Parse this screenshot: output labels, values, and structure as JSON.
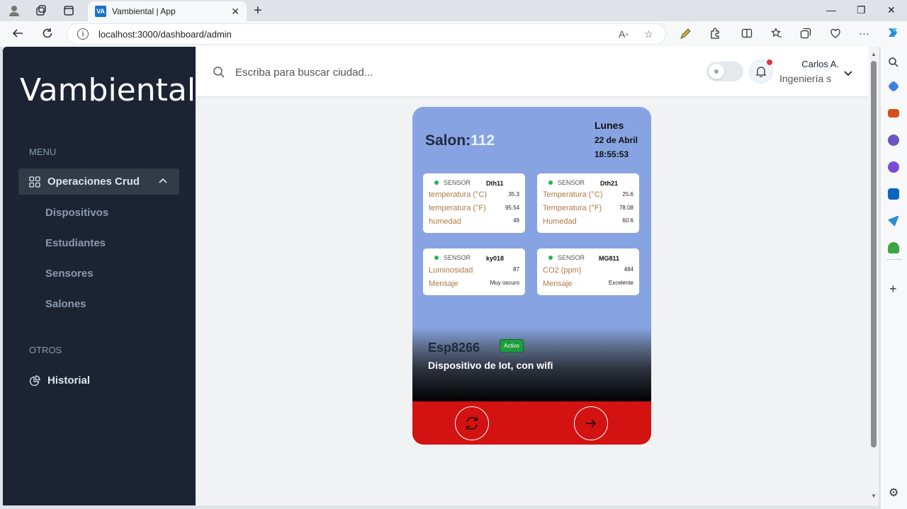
{
  "browser": {
    "tab_title": "Vambiental | App",
    "tab_favicon": "VA",
    "url": "localhost:3000/dashboard/admin"
  },
  "sidebar": {
    "brand": "Vambiental",
    "menu_label": "MENU",
    "crud_label": "Operaciones Crud",
    "sub_items": [
      "Dispositivos",
      "Estudiantes",
      "Sensores",
      "Salones"
    ],
    "others_label": "OTROS",
    "history_label": "Historial"
  },
  "header": {
    "search_placeholder": "Escriba para buscar ciudad...",
    "user_name": "Carlos A.",
    "user_role": "Ingeniería s"
  },
  "card": {
    "salon_label": "Salon:",
    "salon_number": "112",
    "day": "Lunes",
    "date": "22 de Abril",
    "time": "18:55:53",
    "sensors": [
      {
        "label": "SENSOR",
        "id": "Dth11",
        "rows": [
          {
            "name": "temperatura (°C)",
            "value": "35.3"
          },
          {
            "name": "temperatura (°F)",
            "value": "95.54"
          },
          {
            "name": "humedad",
            "value": "49"
          }
        ]
      },
      {
        "label": "SENSOR",
        "id": "Dth21",
        "rows": [
          {
            "name": "Temperatura (°C)",
            "value": "25.6"
          },
          {
            "name": "Temperatura (°F)",
            "value": "78.08"
          },
          {
            "name": "Humedad",
            "value": "60.6"
          }
        ]
      },
      {
        "label": "SENSOR",
        "id": "ky018",
        "rows": [
          {
            "name": "Luminosidad",
            "value": "87"
          },
          {
            "name": "Mensaje",
            "value": "Muy oscuro"
          }
        ]
      },
      {
        "label": "SENSOR",
        "id": "MG811",
        "rows": [
          {
            "name": "CO2 (ppm)",
            "value": "484"
          },
          {
            "name": "Mensaje",
            "value": "Excelente"
          }
        ]
      }
    ],
    "device_name": "Esp8266",
    "status_badge": "Activo",
    "device_desc": "Dispositivo de Iot, con wifi"
  },
  "colors": {
    "sidebar_bg": "#1c2434",
    "card_bg": "#87a3e2",
    "card_footer": "#d31212",
    "status_green": "#1e9e3b"
  }
}
